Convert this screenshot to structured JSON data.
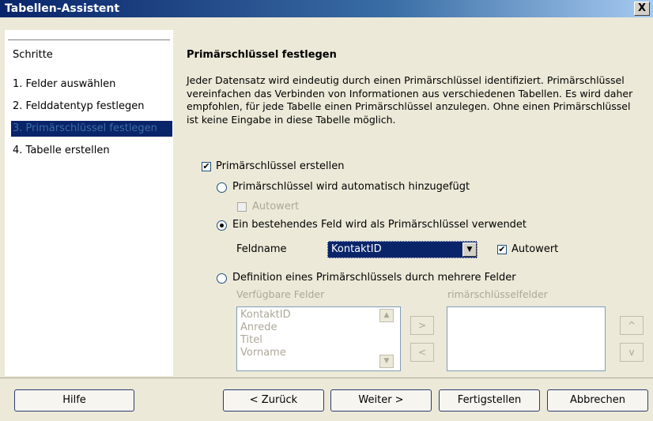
{
  "window": {
    "title": "Tabellen-Assistent",
    "close_glyph": "X"
  },
  "steps": {
    "heading": "Schritte",
    "items": [
      {
        "label": "1. Felder auswählen",
        "selected": false
      },
      {
        "label": "2. Felddatentyp festlegen",
        "selected": false
      },
      {
        "label": "3. Primärschlüssel festlegen",
        "selected": true
      },
      {
        "label": "4. Tabelle erstellen",
        "selected": false
      }
    ]
  },
  "page": {
    "heading": "Primärschlüssel festlegen",
    "description": "Jeder Datensatz wird eindeutig durch einen Primärschlüssel identifiziert. Primärschlüssel vereinfachen das Verbinden von Informationen aus verschiedenen Tabellen. Es wird daher empfohlen, für jede Tabelle einen Primärschlüssel anzulegen. Ohne einen Primärschlüssel ist keine Eingabe in diese Tabelle möglich.",
    "create_pk": {
      "label": "Primärschlüssel erstellen",
      "checked": true
    },
    "option_auto": {
      "label": "Primärschlüssel wird automatisch hinzugefügt",
      "selected": false
    },
    "auto_value_1": {
      "label": "Autowert",
      "checked": false,
      "enabled": false
    },
    "option_existing": {
      "label": "Ein bestehendes Feld wird als Primärschlüssel verwendet",
      "selected": true
    },
    "fieldname": {
      "label": "Feldname",
      "value": "KontaktID"
    },
    "auto_value_2": {
      "label": "Autowert",
      "checked": true
    },
    "option_multi": {
      "label": "Definition eines Primärschlüssels durch mehrere Felder",
      "selected": false
    },
    "available": {
      "label": "Verfügbare Felder",
      "items": [
        "KontaktID",
        "Anrede",
        "Titel",
        "Vorname"
      ]
    },
    "pk_fields": {
      "label": "rimärschlüsselfelder",
      "items": []
    },
    "move_right": ">",
    "move_left": "<",
    "move_up": "^",
    "move_down": "v",
    "scroll_up": "▲",
    "scroll_down": "▼",
    "combo_arrow": "▼",
    "check_glyph": "✔"
  },
  "buttons": {
    "help": "Hilfe",
    "back": "< Zurück",
    "next": "Weiter >",
    "finish": "Fertigstellen",
    "cancel": "Abbrechen"
  }
}
